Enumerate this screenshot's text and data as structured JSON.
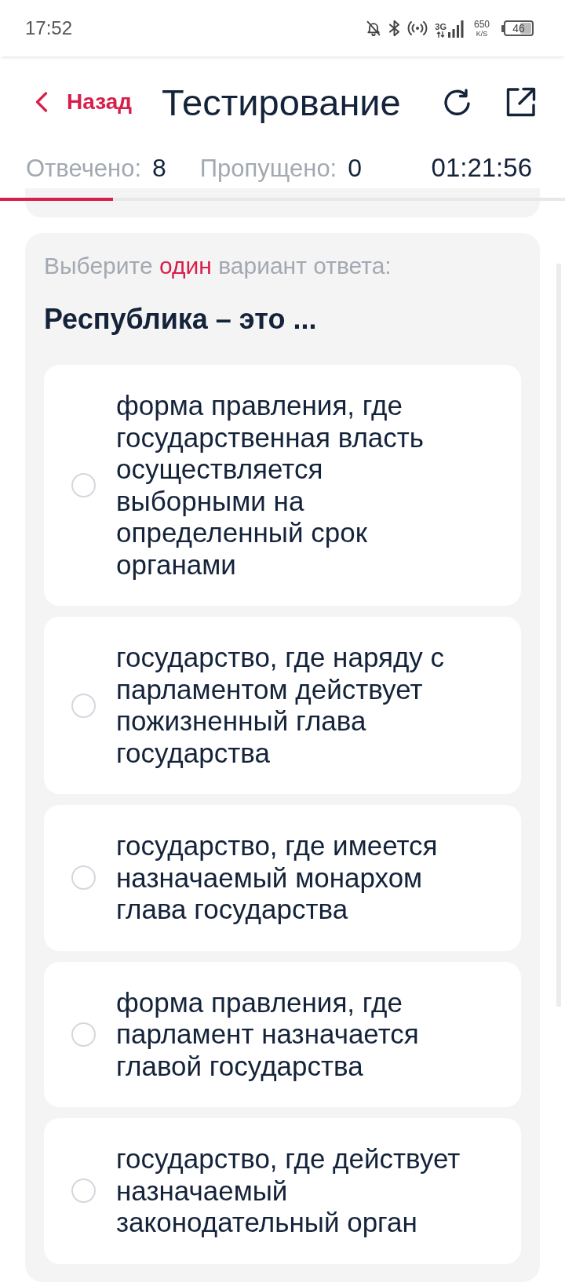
{
  "status_bar": {
    "time": "17:52",
    "network_type": "3G",
    "speed_value": "650",
    "speed_unit": "K/S",
    "battery": "46"
  },
  "header": {
    "back_label": "Назад",
    "title": "Тестирование"
  },
  "stats": [
    {
      "label": "Отвечено:",
      "value": "8"
    },
    {
      "label": "Пропущено:",
      "value": "0"
    }
  ],
  "timer": "01:21:56",
  "progress_bar": {
    "level": 0.2
  },
  "question": {
    "instruction": "Выберите **один** вариант ответа:",
    "text": "Республика – это ...",
    "options": [
      {
        "text": "форма правления, где государственная власть осуществляется выборными на определенный срок органами",
        "selected": false
      },
      {
        "text": "государство, где наряду с парламентом действует пожизненный глава государства",
        "selected": false
      },
      {
        "text": "государство, где имеется назначаемый монархом глава государства",
        "selected": false
      },
      {
        "text": "форма правления, где парламент назначается главой государства",
        "selected": false
      },
      {
        "text": "государство, где действует назначаемый законодательный орган",
        "selected": false
      }
    ]
  }
}
